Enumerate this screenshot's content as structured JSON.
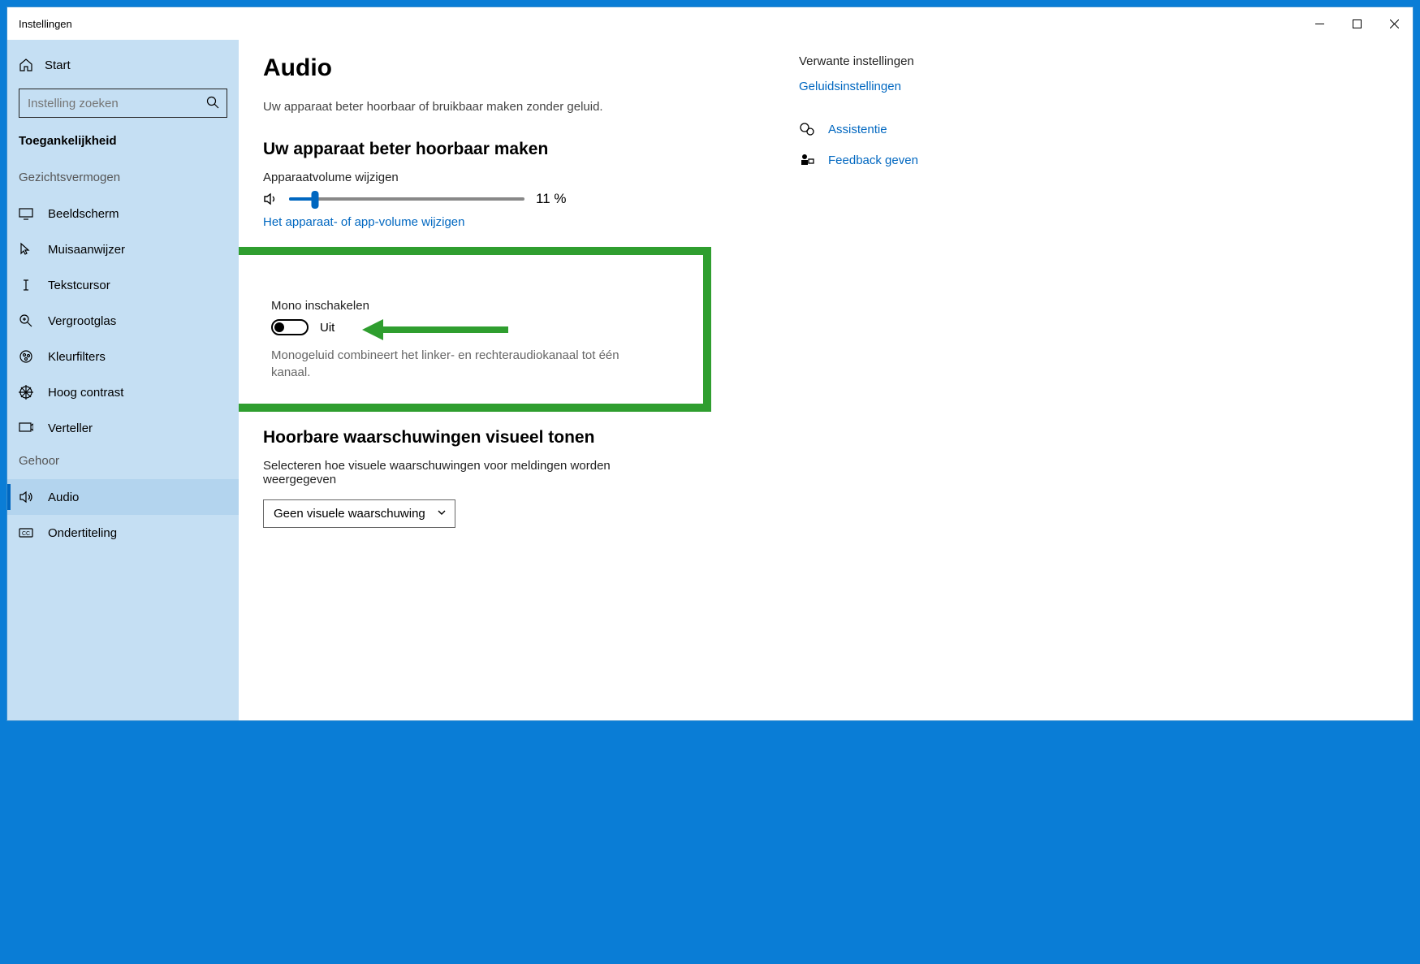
{
  "window": {
    "title": "Instellingen"
  },
  "sidebar": {
    "start": "Start",
    "search_placeholder": "Instelling zoeken",
    "section": "Toegankelijkheid",
    "group_vision": "Gezichtsvermogen",
    "group_hearing": "Gehoor",
    "items_vision": [
      {
        "label": "Beeldscherm"
      },
      {
        "label": "Muisaanwijzer"
      },
      {
        "label": "Tekstcursor"
      },
      {
        "label": "Vergrootglas"
      },
      {
        "label": "Kleurfilters"
      },
      {
        "label": "Hoog contrast"
      },
      {
        "label": "Verteller"
      }
    ],
    "items_hearing": [
      {
        "label": "Audio"
      },
      {
        "label": "Ondertiteling"
      }
    ]
  },
  "main": {
    "title": "Audio",
    "subtitle": "Uw apparaat beter hoorbaar of bruikbaar maken zonder geluid.",
    "section1": {
      "heading": "Uw apparaat beter hoorbaar maken",
      "volume_label": "Apparaatvolume wijzigen",
      "volume_percent": 11,
      "volume_text": "11 %",
      "link": "Het apparaat- of app-volume wijzigen"
    },
    "mono": {
      "heading": "Mono inschakelen",
      "state": "Uit",
      "desc": "Monogeluid combineert het linker- en rechteraudiokanaal tot één kanaal."
    },
    "section2": {
      "heading": "Hoorbare waarschuwingen visueel tonen",
      "label": "Selecteren hoe visuele waarschuwingen voor meldingen worden weergegeven",
      "select_value": "Geen visuele waarschuwing"
    }
  },
  "right": {
    "title": "Verwante instellingen",
    "link": "Geluidsinstellingen",
    "help": "Assistentie",
    "feedback": "Feedback geven"
  }
}
